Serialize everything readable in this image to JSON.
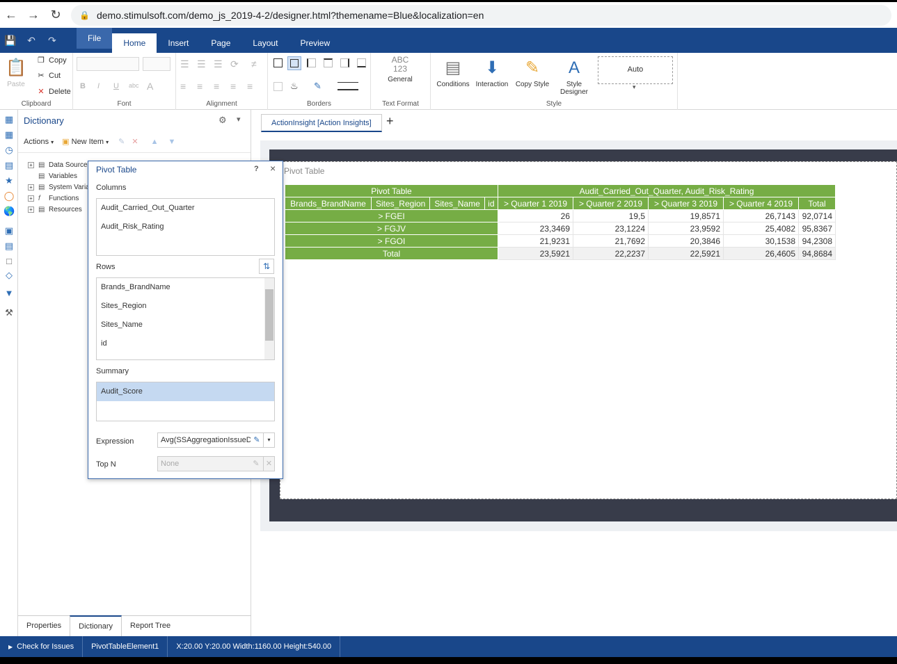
{
  "browser": {
    "url": "demo.stimulsoft.com/demo_js_2019-4-2/designer.html?themename=Blue&localization=en"
  },
  "ribbon": {
    "tabs": [
      "File",
      "Home",
      "Insert",
      "Page",
      "Layout",
      "Preview"
    ],
    "active_tab": "Home",
    "groups": {
      "clipboard": {
        "label": "Clipboard",
        "paste": "Paste",
        "copy": "Copy",
        "cut": "Cut",
        "delete": "Delete"
      },
      "font": {
        "label": "Font"
      },
      "alignment": {
        "label": "Alignment"
      },
      "borders": {
        "label": "Borders"
      },
      "text_format": {
        "label": "Text Format",
        "icon_text1": "ABC",
        "icon_text2": "123",
        "general": "General"
      },
      "style": {
        "label": "Style",
        "conditions": "Conditions",
        "interaction": "Interaction",
        "copy_style": "Copy Style",
        "style_designer": "Style Designer",
        "auto": "Auto"
      }
    }
  },
  "dictionary": {
    "title": "Dictionary",
    "actions": "Actions",
    "new_item": "New Item",
    "tree": [
      "Data Sources",
      "Variables",
      "System Varia",
      "Functions",
      "Resources"
    ],
    "tabs": [
      "Properties",
      "Dictionary",
      "Report Tree"
    ],
    "active_tab": "Dictionary"
  },
  "pivot_dialog": {
    "title": "Pivot Table",
    "help": "?",
    "close": "×",
    "columns_label": "Columns",
    "columns": [
      "Audit_Carried_Out_Quarter",
      "Audit_Risk_Rating"
    ],
    "rows_label": "Rows",
    "rows": [
      "Brands_BrandName",
      "Sites_Region",
      "Sites_Name",
      "id"
    ],
    "summary_label": "Summary",
    "summary": [
      "Audit_Score"
    ],
    "expression_label": "Expression",
    "expression_value": "Avg(SSAggregationIssueDS",
    "topn_label": "Top N",
    "topn_value": "None"
  },
  "document": {
    "tab_label": "ActionInsight [Action Insights]",
    "add_tab": "+",
    "element_title": "Pivot Table"
  },
  "pivot_table": {
    "corner": "Pivot Table",
    "column_header": "Audit_Carried_Out_Quarter, Audit_Risk_Rating",
    "row_headers": [
      "Brands_BrandName",
      "Sites_Region",
      "Sites_Name",
      "id"
    ],
    "quarters": [
      "> Quarter 1 2019",
      "> Quarter 2 2019",
      "> Quarter 3 2019",
      "> Quarter 4 2019",
      "Total"
    ],
    "rows": [
      {
        "label": "> FGEI",
        "values": [
          "26",
          "19,5",
          "19,8571",
          "26,7143",
          "92,0714"
        ]
      },
      {
        "label": "> FGJV",
        "values": [
          "23,3469",
          "23,1224",
          "23,9592",
          "25,4082",
          "95,8367"
        ]
      },
      {
        "label": "> FGOI",
        "values": [
          "21,9231",
          "21,7692",
          "20,3846",
          "30,1538",
          "94,2308"
        ]
      }
    ],
    "total": {
      "label": "Total",
      "values": [
        "23,5921",
        "22,2237",
        "22,5921",
        "26,4605",
        "94,8684"
      ]
    }
  },
  "status_bar": {
    "check": "Check for Issues",
    "element": "PivotTableElement1",
    "geometry": "X:20.00 Y:20.00 Width:1160.00 Height:540.00"
  },
  "colors": {
    "brand": "#19478a",
    "pivot_header": "#76ad45",
    "selection": "#c5d9f1"
  }
}
